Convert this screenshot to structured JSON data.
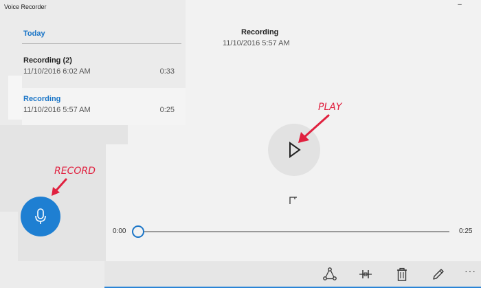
{
  "app": {
    "title": "Voice Recorder",
    "minimize_glyph": "–"
  },
  "sidebar": {
    "section_label": "Today",
    "recordings": [
      {
        "name": "Recording (2)",
        "date": "11/10/2016 6:02 AM",
        "duration": "0:33",
        "selected": false
      },
      {
        "name": "Recording",
        "date": "11/10/2016 5:57 AM",
        "duration": "0:25",
        "selected": true
      }
    ]
  },
  "player": {
    "title": "Recording",
    "date": "11/10/2016 5:57 AM",
    "time_start": "0:00",
    "time_end": "0:25",
    "progress": 0
  },
  "annotations": {
    "play": "PLAY",
    "record": "RECORD"
  },
  "toolbar": {
    "icons": [
      "share-icon",
      "trim-icon",
      "delete-icon",
      "rename-icon"
    ],
    "more_label": "···"
  },
  "colors": {
    "accent": "#1e7fd2",
    "annotation": "#e0213f",
    "selected_text": "#1a75c7"
  }
}
